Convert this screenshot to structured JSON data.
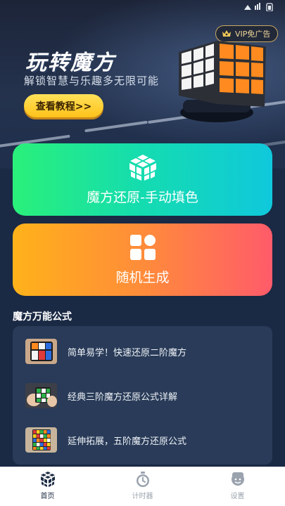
{
  "status_bar": {
    "time": "",
    "icons": ""
  },
  "header": {
    "vip_label": "VIP免广告",
    "title": "玩转魔方",
    "subtitle": "解锁智慧与乐趣多无限可能",
    "tutorial_button": "查看教程>>"
  },
  "cards": {
    "restore_label": "魔方还原-手动填色",
    "random_label": "随机生成"
  },
  "formulas": {
    "section_title": "魔方万能公式",
    "items": [
      {
        "text": "简单易学！快速还原二阶魔方"
      },
      {
        "text": "经典三阶魔方还原公式详解"
      },
      {
        "text": "延伸拓展，五阶魔方还原公式"
      }
    ]
  },
  "tabbar": {
    "tabs": [
      {
        "label": "首页",
        "icon": "cube-icon",
        "active": true
      },
      {
        "label": "计时器",
        "icon": "stopwatch-icon",
        "active": false
      },
      {
        "label": "设置",
        "icon": "settings-face-icon",
        "active": false
      }
    ]
  },
  "colors": {
    "restore_gradient": [
      "#2af07a",
      "#10c8dc"
    ],
    "random_gradient": [
      "#ffb21a",
      "#ff5b6a"
    ],
    "tutorial_button": "#ffd21f",
    "background": "#1a2944"
  }
}
